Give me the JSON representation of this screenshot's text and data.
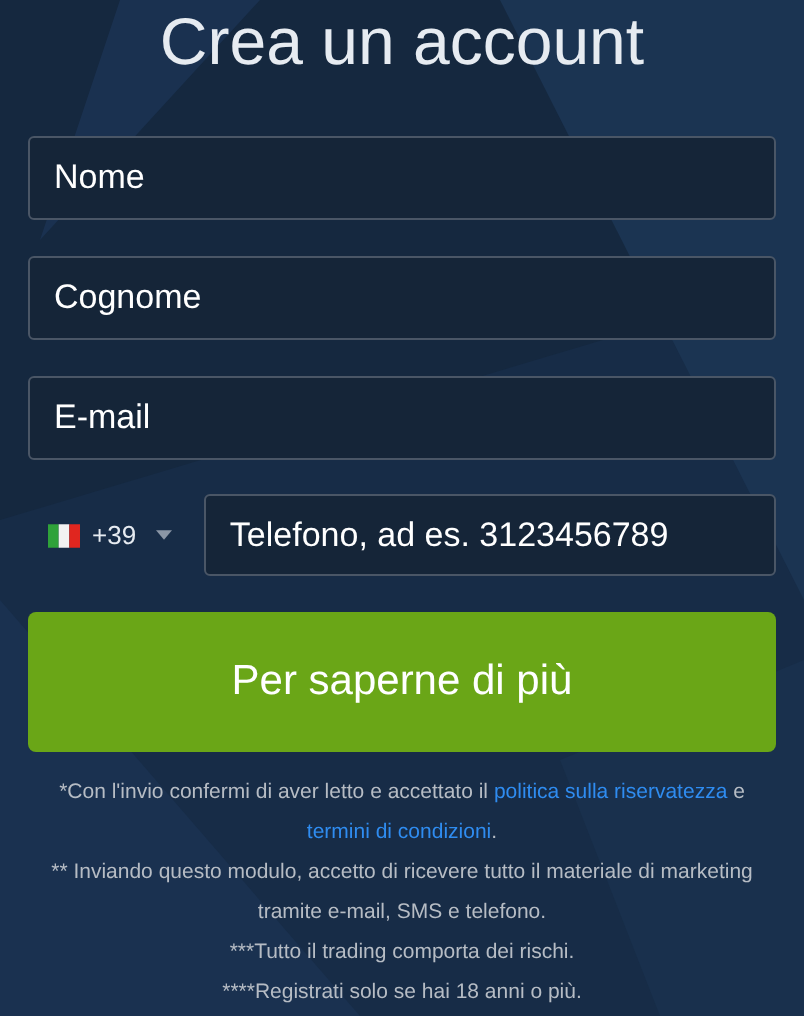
{
  "title": "Crea un account",
  "fields": [
    {
      "placeholder": "Nome"
    },
    {
      "placeholder": "Cognome"
    },
    {
      "placeholder": "E-mail"
    }
  ],
  "phone": {
    "code": "+39",
    "placeholder": "Telefono, ad es. 3123456789"
  },
  "submit": "Per saperne di più",
  "consent": {
    "text": "*Con l'invio confermi di aver letto e accettato il",
    "link_1": "politica sulla riservatezza",
    "middle": "e",
    "link_2": "termini di condizioni",
    "end": "."
  },
  "notes": [
    "** Inviando questo modulo, accetto di ricevere tutto il materiale di marketing tramite e-mail, SMS e telefono.",
    "***Tutto il trading comporta dei rischi.",
    "****Registrati solo se hai 18 anni o più."
  ]
}
